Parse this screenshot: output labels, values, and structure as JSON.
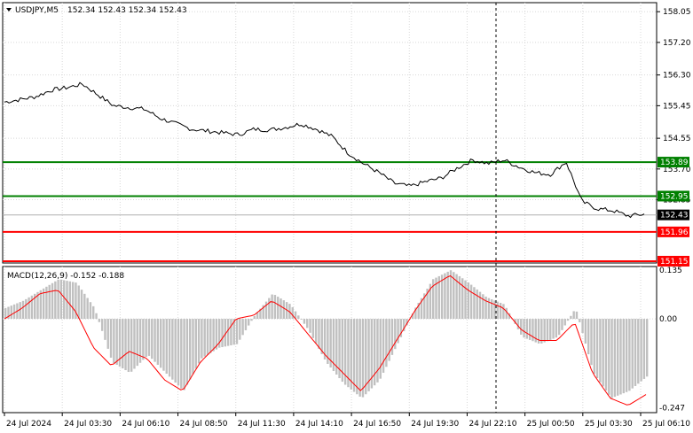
{
  "header": {
    "symbol_timeframe": "USDJPY,M5",
    "ohlc": "152.34 152.43 152.34 152.43",
    "dropdown_icon": "triangle-down-icon"
  },
  "macd": {
    "label": "MACD(12,26,9) -0.152 -0.188",
    "scale_labels": [
      "0.135",
      "0.00",
      "-0.247"
    ]
  },
  "colors": {
    "price_line": "#000000",
    "grid": "#c8c8c8",
    "green_level": "#008000",
    "red_level": "#ff0000",
    "histogram": "#c0c0c0",
    "signal_line": "#ff0000",
    "current_price_tag": "#000000"
  },
  "chart_data": {
    "type": "line",
    "symbol": "USDJPY",
    "timeframe": "M5",
    "y_tick_labels": [
      "158.05",
      "157.20",
      "156.30",
      "155.45",
      "154.55",
      "153.70",
      "152.85"
    ],
    "ylim": [
      151.1,
      158.3
    ],
    "x_tick_labels": [
      "24 Jul 2024",
      "24 Jul 03:30",
      "24 Jul 06:10",
      "24 Jul 08:50",
      "24 Jul 11:30",
      "24 Jul 14:10",
      "24 Jul 16:50",
      "24 Jul 19:30",
      "24 Jul 22:10",
      "25 Jul 00:50",
      "25 Jul 03:30",
      "25 Jul 06:10"
    ],
    "levels": [
      {
        "value": 153.89,
        "label": "153.89",
        "color": "#008000"
      },
      {
        "value": 152.95,
        "label": "152.95",
        "color": "#008000"
      },
      {
        "value": 151.96,
        "label": "151.96",
        "color": "#ff0000"
      },
      {
        "value": 151.15,
        "label": "151.15",
        "color": "#ff0000"
      }
    ],
    "current_price": {
      "value": 152.43,
      "label": "152.43"
    },
    "price_series": [
      155.55,
      155.62,
      155.7,
      155.88,
      155.95,
      156.05,
      155.75,
      155.45,
      155.4,
      155.35,
      155.1,
      154.95,
      154.8,
      154.75,
      154.7,
      154.65,
      154.8,
      154.78,
      154.85,
      154.95,
      154.8,
      154.6,
      154.15,
      153.85,
      153.6,
      153.3,
      153.22,
      153.35,
      153.45,
      153.72,
      153.95,
      153.85,
      153.95,
      153.75,
      153.6,
      153.55,
      153.9,
      152.8,
      152.6,
      152.55,
      152.4,
      152.45
    ],
    "macd": {
      "ylim": [
        -0.26,
        0.145
      ],
      "histogram": [
        0.03,
        0.05,
        0.08,
        0.11,
        0.1,
        0.03,
        -0.12,
        -0.15,
        -0.1,
        -0.15,
        -0.2,
        -0.11,
        -0.08,
        -0.07,
        0.01,
        0.07,
        0.04,
        -0.03,
        -0.12,
        -0.18,
        -0.22,
        -0.17,
        -0.07,
        0.03,
        0.11,
        0.135,
        0.1,
        0.06,
        0.04,
        -0.05,
        -0.07,
        -0.05,
        0.03,
        -0.15,
        -0.22,
        -0.2,
        -0.16
      ],
      "signal": [
        0.0,
        0.03,
        0.07,
        0.08,
        0.02,
        -0.08,
        -0.13,
        -0.09,
        -0.11,
        -0.17,
        -0.2,
        -0.12,
        -0.07,
        0.0,
        0.01,
        0.05,
        0.02,
        -0.04,
        -0.1,
        -0.15,
        -0.2,
        -0.14,
        -0.06,
        0.02,
        0.09,
        0.12,
        0.08,
        0.05,
        0.03,
        -0.03,
        -0.06,
        -0.06,
        -0.01,
        -0.15,
        -0.22,
        -0.24,
        -0.21
      ]
    }
  }
}
